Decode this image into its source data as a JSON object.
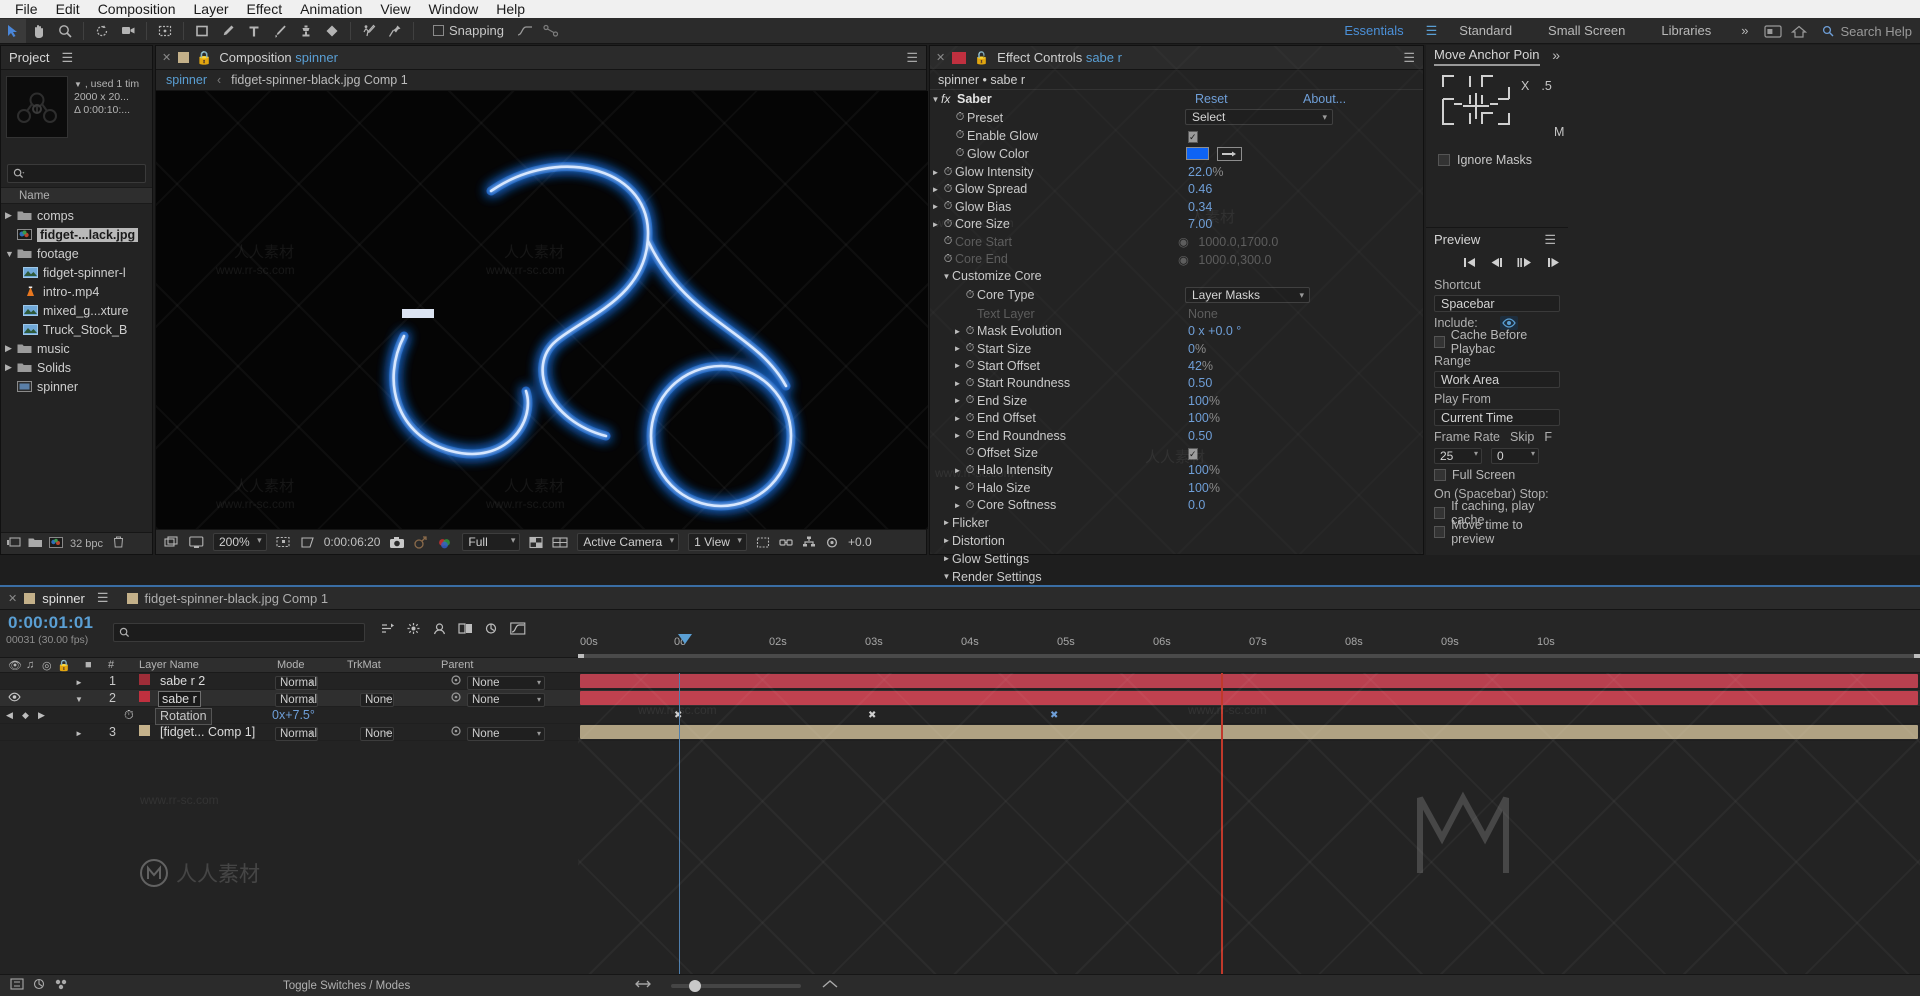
{
  "menubar": [
    "File",
    "Edit",
    "Composition",
    "Layer",
    "Effect",
    "Animation",
    "View",
    "Window",
    "Help"
  ],
  "toolbar": {
    "snapping_label": "Snapping",
    "workspaces": [
      "Essentials",
      "Standard",
      "Small Screen",
      "Libraries"
    ],
    "active_workspace": "Essentials",
    "overflow": "»",
    "search_placeholder": "Search Help"
  },
  "project": {
    "title": "Project",
    "selected_info": {
      "used": ", used 1 tim",
      "dimensions": "2000 x 20...",
      "duration": "Δ 0:00:10:..."
    },
    "column_header": "Name",
    "items": [
      {
        "label": "comps",
        "type": "folder",
        "twirl": "▶",
        "indent": 0,
        "selected": false
      },
      {
        "label": "fidget-...lack.jpg",
        "type": "image",
        "twirl": "",
        "indent": 0,
        "selected": true
      },
      {
        "label": "footage",
        "type": "folder",
        "twirl": "▼",
        "indent": 0,
        "selected": false
      },
      {
        "label": "fidget-spinner-l",
        "type": "footage",
        "twirl": "",
        "indent": 1,
        "selected": false
      },
      {
        "label": "intro-.mp4",
        "type": "video",
        "twirl": "",
        "indent": 1,
        "selected": false
      },
      {
        "label": "mixed_g...xture",
        "type": "footage",
        "twirl": "",
        "indent": 1,
        "selected": false
      },
      {
        "label": "Truck_Stock_B",
        "type": "footage",
        "twirl": "",
        "indent": 1,
        "selected": false
      },
      {
        "label": "music",
        "type": "folder",
        "twirl": "▶",
        "indent": 0,
        "selected": false
      },
      {
        "label": "Solids",
        "type": "folder",
        "twirl": "▶",
        "indent": 0,
        "selected": false
      },
      {
        "label": "spinner",
        "type": "comp",
        "twirl": "",
        "indent": 0,
        "selected": false
      }
    ],
    "bitdepth": "32 bpc"
  },
  "composition": {
    "tab_label": "Composition",
    "tab_name": "spinner",
    "breadcrumb_comp": "spinner",
    "breadcrumb_sep": "‹",
    "breadcrumb_child": "fidget-spinner-black.jpg Comp 1",
    "zoom": "200%",
    "timecode": "0:00:06:20",
    "resolution": "Full",
    "camera": "Active Camera",
    "views": "1 View",
    "exposure": "+0.0"
  },
  "effect_controls": {
    "tab_label": "Effect Controls",
    "tab_layer": "sabe r",
    "layer_path": "spinner • sabe r",
    "effect_name": "Saber",
    "reset": "Reset",
    "about": "About...",
    "rows": [
      {
        "label": "Preset",
        "value": "Select",
        "kind": "select",
        "indent": 1,
        "twirl": false,
        "dim": false
      },
      {
        "label": "Enable Glow",
        "value": "",
        "kind": "checkbox",
        "indent": 1,
        "twirl": false,
        "dim": false
      },
      {
        "label": "Glow Color",
        "value": "",
        "kind": "color",
        "indent": 1,
        "twirl": false,
        "dim": false
      },
      {
        "label": "Glow Intensity",
        "value": "22.0",
        "unit": "%",
        "kind": "num",
        "indent": 1,
        "twirl": true,
        "dim": false
      },
      {
        "label": "Glow Spread",
        "value": "0.46",
        "unit": "",
        "kind": "num",
        "indent": 1,
        "twirl": true,
        "dim": false
      },
      {
        "label": "Glow Bias",
        "value": "0.34",
        "unit": "",
        "kind": "num",
        "indent": 1,
        "twirl": true,
        "dim": false
      },
      {
        "label": "Core Size",
        "value": "7.00",
        "unit": "",
        "kind": "num",
        "indent": 1,
        "twirl": true,
        "dim": false
      },
      {
        "label": "Core Start",
        "value": "1000.0,1700.0",
        "unit": "",
        "kind": "point",
        "indent": 1,
        "twirl": false,
        "dim": true
      },
      {
        "label": "Core End",
        "value": "1000.0,300.0",
        "unit": "",
        "kind": "point",
        "indent": 1,
        "twirl": false,
        "dim": true
      },
      {
        "label": "Customize Core",
        "value": "",
        "kind": "group",
        "indent": 0,
        "twirl": true,
        "dim": false
      },
      {
        "label": "Core Type",
        "value": "Layer Masks",
        "kind": "select",
        "indent": 2,
        "twirl": false,
        "dim": false
      },
      {
        "label": "Text Layer",
        "value": "None",
        "kind": "text",
        "indent": 2,
        "twirl": false,
        "dim": true
      },
      {
        "label": "Mask Evolution",
        "value": "0 x +0.0 °",
        "unit": "",
        "kind": "num",
        "indent": 2,
        "twirl": true,
        "dim": false
      },
      {
        "label": "Start Size",
        "value": "0",
        "unit": "%",
        "kind": "num",
        "indent": 2,
        "twirl": true,
        "dim": false
      },
      {
        "label": "Start Offset",
        "value": "42",
        "unit": "%",
        "kind": "num",
        "indent": 2,
        "twirl": true,
        "dim": false
      },
      {
        "label": "Start Roundness",
        "value": "0.50",
        "unit": "",
        "kind": "num",
        "indent": 2,
        "twirl": true,
        "dim": false
      },
      {
        "label": "End Size",
        "value": "100",
        "unit": "%",
        "kind": "num",
        "indent": 2,
        "twirl": true,
        "dim": false
      },
      {
        "label": "End Offset",
        "value": "100",
        "unit": "%",
        "kind": "num",
        "indent": 2,
        "twirl": true,
        "dim": false
      },
      {
        "label": "End Roundness",
        "value": "0.50",
        "unit": "",
        "kind": "num",
        "indent": 2,
        "twirl": true,
        "dim": false
      },
      {
        "label": "Offset Size",
        "value": "",
        "kind": "checkbox",
        "indent": 2,
        "twirl": false,
        "dim": false
      },
      {
        "label": "Halo Intensity",
        "value": "100",
        "unit": "%",
        "kind": "num",
        "indent": 2,
        "twirl": true,
        "dim": false
      },
      {
        "label": "Halo Size",
        "value": "100",
        "unit": "%",
        "kind": "num",
        "indent": 2,
        "twirl": true,
        "dim": false
      },
      {
        "label": "Core Softness",
        "value": "0.0",
        "unit": "",
        "kind": "num",
        "indent": 2,
        "twirl": false,
        "dim": false
      },
      {
        "label": "Flicker",
        "value": "",
        "kind": "group",
        "indent": 0,
        "twirl": false,
        "dim": false
      },
      {
        "label": "Distortion",
        "value": "",
        "kind": "group",
        "indent": 0,
        "twirl": false,
        "dim": false
      },
      {
        "label": "Glow Settings",
        "value": "",
        "kind": "group",
        "indent": 0,
        "twirl": false,
        "dim": false
      },
      {
        "label": "Render Settings",
        "value": "",
        "kind": "group",
        "indent": 0,
        "twirl": true,
        "dim": false
      }
    ]
  },
  "anchor_panel": {
    "title": "Move Anchor Poin",
    "x_label": "X",
    "x_value": ".5",
    "m_label": "M",
    "ignore_masks": "Ignore Masks"
  },
  "preview_panel": {
    "title": "Preview",
    "shortcut_label": "Shortcut",
    "shortcut_value": "Spacebar",
    "include_label": "Include:",
    "cache_label": "Cache Before Playbac",
    "range_label": "Range",
    "range_value": "Work Area",
    "playfrom_label": "Play From",
    "playfrom_value": "Current Time",
    "framerate_label": "Frame Rate",
    "skip_label": "Skip",
    "res_label": "F",
    "framerate_value": "25",
    "skip_value": "0",
    "fullscreen_label": "Full Screen",
    "onstop_label": "On (Spacebar) Stop:",
    "if_caching_label": "If caching, play cache",
    "move_time_label": "Move time to preview"
  },
  "timeline": {
    "tab_name": "spinner",
    "tab_child": "fidget-spinner-black.jpg Comp 1",
    "current_time": "0:00:01:01",
    "fps_note": "00031 (30.00 fps)",
    "columns": {
      "num": "#",
      "layer_name": "Layer Name",
      "mode": "Mode",
      "trkmat": "TrkMat",
      "parent": "Parent"
    },
    "ruler_ticks": [
      "00s",
      "0с",
      "02s",
      "03s",
      "04s",
      "05s",
      "06s",
      "07s",
      "08s",
      "09s",
      "10s"
    ],
    "layers": [
      {
        "num": "1",
        "name": "sabe r 2",
        "mode": "Normal",
        "trkmat": "",
        "parent": "None",
        "swatch": "#9e2d38",
        "selected": false,
        "boxed": false,
        "visible": false,
        "bar_color": "#b8404f",
        "bar_start": 0,
        "bar_end": 100
      },
      {
        "num": "2",
        "name": "sabe r",
        "mode": "Normal",
        "trkmat": "None",
        "parent": "None",
        "swatch": "#c0303f",
        "selected": true,
        "boxed": true,
        "visible": true,
        "bar_color": "#c0414f",
        "bar_start": 0,
        "bar_end": 100
      },
      {
        "num": "3",
        "name": "[fidget... Comp 1]",
        "mode": "Normal",
        "trkmat": "None",
        "parent": "None",
        "swatch": "#c4b18a",
        "selected": false,
        "boxed": false,
        "visible": false,
        "bar_color": "#b0a283",
        "bar_start": 0,
        "bar_end": 100
      }
    ],
    "property": {
      "name": "Rotation",
      "value": "0x+7.5°"
    },
    "footer_label": "Toggle Switches / Modes"
  },
  "colors": {
    "accent_blue": "#5a9fd4",
    "value_blue": "#6f9fd8",
    "glow_color": "#0d63f5",
    "cti_red": "#c0392b",
    "layer_red": "#c0414f",
    "layer_tan": "#b0a283"
  }
}
